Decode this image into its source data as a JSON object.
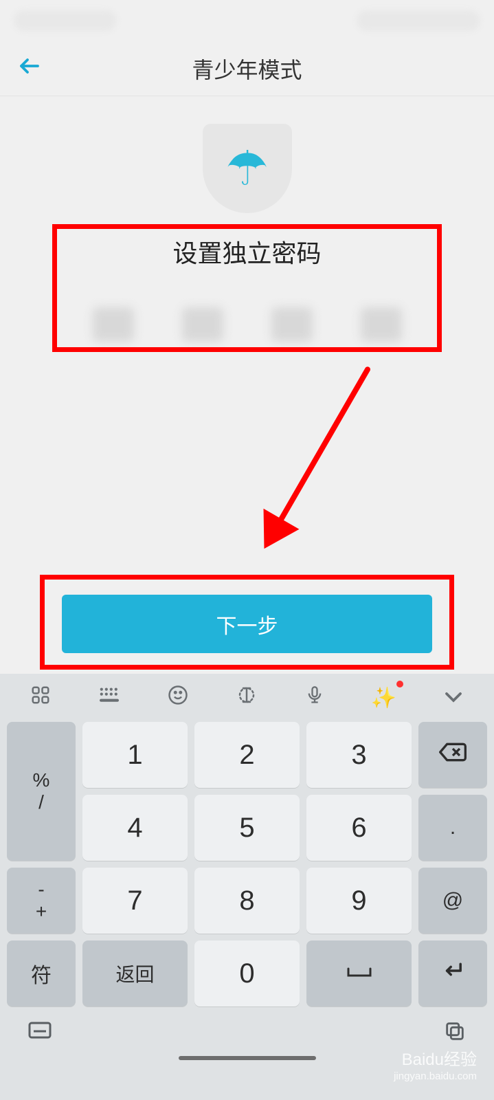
{
  "nav": {
    "title": "青少年模式"
  },
  "content": {
    "prompt": "设置独立密码",
    "next_button": "下一步"
  },
  "keyboard": {
    "keys_row1": {
      "side_top": "%",
      "side_bot": "/",
      "k1": "1",
      "k2": "2",
      "k3": "3"
    },
    "keys_row2": {
      "side_top": "-",
      "side_bot": "+",
      "k4": "4",
      "k5": "5",
      "k6": "6",
      "dot": "."
    },
    "keys_row3": {
      "k7": "7",
      "k8": "8",
      "k9": "9",
      "at": "@"
    },
    "keys_row4": {
      "sym": "符",
      "back": "返回",
      "k0": "0",
      "space": "␣",
      "enter": "↵"
    }
  },
  "watermark": {
    "main": "Baidu经验",
    "sub": "jingyan.baidu.com"
  }
}
